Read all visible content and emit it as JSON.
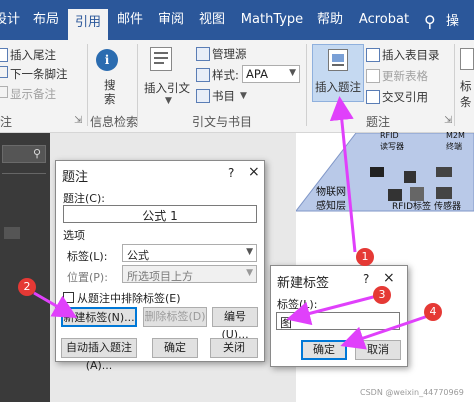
{
  "ribbon_tabs": [
    "设计",
    "布局",
    "引用",
    "邮件",
    "审阅",
    "视图",
    "MathType",
    "帮助",
    "Acrobat"
  ],
  "active_tab": "引用",
  "ribbon": {
    "footnote_insert": "插入尾注",
    "footnote_next": "下一条脚注",
    "footnote_show": "显示备注",
    "footnote_group_partial": "注",
    "search_label": "搜索",
    "info_group": "信息检索",
    "insert_citation": "插入引文",
    "manage_sources": "管理源",
    "style_label": "样式:",
    "style_value": "APA",
    "bibliography": "书目",
    "citations_group": "引文与书目",
    "insert_caption": "插入题注",
    "insert_table_of_figures": "插入表目录",
    "update_table": "更新表格",
    "cross_reference": "交叉引用",
    "captions_group": "题注",
    "index_partial_1": "标",
    "index_partial_2": "条"
  },
  "colors": {
    "ribbon_blue": "#2b579a",
    "arrow": "#e040fb",
    "marker_red": "#e53935",
    "focus_blue": "#0078d7"
  },
  "doc_figure": {
    "rfid_reader": "RFID",
    "rfid_reader_sub": "读写器",
    "m2m": "M2M",
    "m2m_sub": "终端",
    "iot_layer_1": "物联网",
    "iot_layer_2": "感知层",
    "rfid_tag": "RFID标签",
    "sensor": "传感器"
  },
  "caption_dialog": {
    "title": "题注",
    "help": "?",
    "close": "×",
    "caption_label": "题注(C):",
    "caption_value": "公式 1",
    "options_label": "选项",
    "label_label": "标签(L):",
    "label_value": "公式",
    "position_label": "位置(P):",
    "position_value": "所选项目上方",
    "exclude_label": "从题注中排除标签(E)",
    "new_label_button": "新建标签(N)...",
    "delete_label_button": "删除标签(D)",
    "numbering_button": "编号(U)...",
    "autocaption_button": "自动插入题注(A)...",
    "ok_button": "确定",
    "close_button": "关闭"
  },
  "new_label_dialog": {
    "title": "新建标签",
    "help": "?",
    "close": "×",
    "label_label": "标签(L):",
    "label_value": "图",
    "ok_button": "确定",
    "cancel_button": "取消"
  },
  "markers": [
    "1",
    "2",
    "3",
    "4"
  ],
  "watermark": "CSDN @weixin_44770969"
}
